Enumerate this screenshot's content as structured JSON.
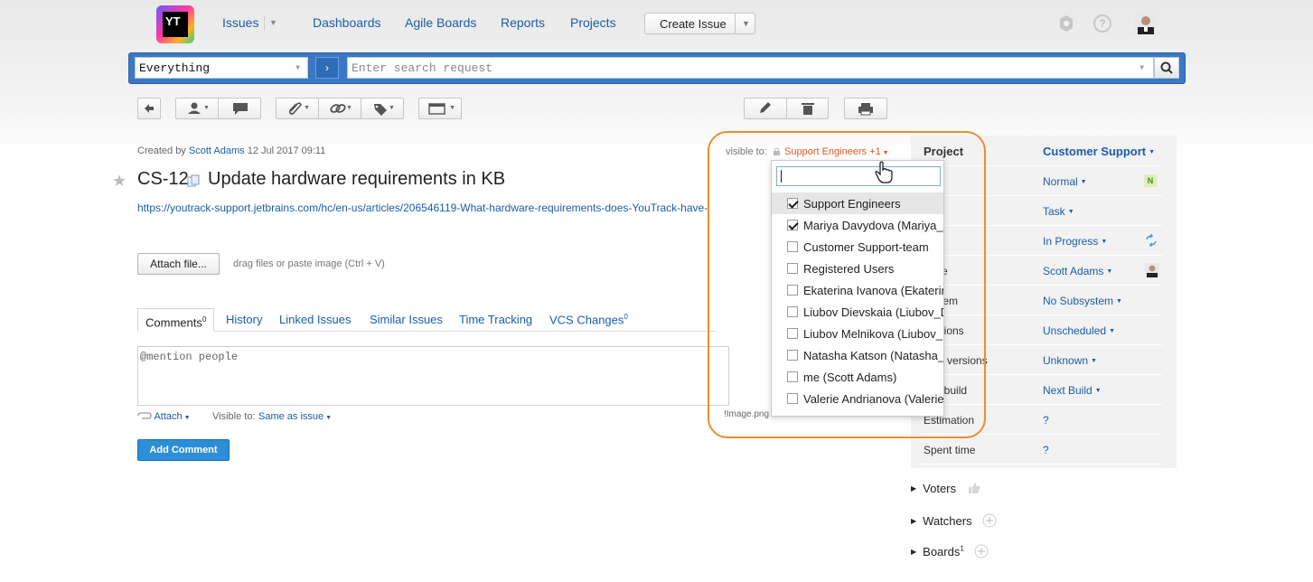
{
  "nav": {
    "logo_text": "YT",
    "issues": "Issues",
    "dashboards": "Dashboards",
    "agile_boards": "Agile Boards",
    "reports": "Reports",
    "projects": "Projects",
    "create_issue": "Create Issue"
  },
  "search": {
    "context": "Everything",
    "placeholder": "Enter search request"
  },
  "issue": {
    "created_prefix": "Created by",
    "author": "Scott Adams",
    "created_date": "12 Jul 2017 09:11",
    "id": "CS-12",
    "summary": "Update hardware requirements in KB",
    "link": "https://youtrack-support.jetbrains.com/hc/en-us/articles/206546119-What-hardware-requirements-does-YouTrack-have-",
    "attach_file": "Attach file...",
    "drag_hint": "drag files or paste image (Ctrl + V)"
  },
  "tabs": {
    "comments": "Comments",
    "comments_count": "0",
    "history": "History",
    "linked": "Linked Issues",
    "similar": "Similar Issues",
    "time": "Time Tracking",
    "vcs": "VCS Changes",
    "vcs_count": "0"
  },
  "comment": {
    "placeholder": "@mention people",
    "attach": "Attach",
    "visible_to_label": "Visible to:",
    "visible_to_value": "Same as issue",
    "image_file": "!Image.png",
    "add_button": "Add Comment"
  },
  "visibility": {
    "label": "visible to:",
    "value": "Support Engineers +1",
    "options": [
      {
        "label": "Support Engineers",
        "checked": true
      },
      {
        "label": "Mariya Davydova (Mariya_",
        "checked": true
      },
      {
        "label": "Customer Support-team",
        "checked": false
      },
      {
        "label": "Registered Users",
        "checked": false
      },
      {
        "label": "Ekaterina Ivanova (Ekaterin",
        "checked": false
      },
      {
        "label": "Liubov Dievskaia (Liubov_D",
        "checked": false
      },
      {
        "label": "Liubov Melnikova (Liubov_",
        "checked": false
      },
      {
        "label": "Natasha Katson (Natasha_",
        "checked": false
      },
      {
        "label": "me (Scott Adams)",
        "checked": false
      },
      {
        "label": "Valerie Andrianova (Valerie",
        "checked": false
      }
    ]
  },
  "fields": [
    {
      "name": "Project",
      "value": "Customer Support",
      "bold": true
    },
    {
      "name": "rity",
      "value": "Normal",
      "badge": "N"
    },
    {
      "name": "e",
      "value": "Task"
    },
    {
      "name": "e",
      "value": "In Progress"
    },
    {
      "name": "gnee",
      "value": "Scott Adams"
    },
    {
      "name": "system",
      "value": "No Subsystem"
    },
    {
      "name": "versions",
      "value": "Unscheduled"
    },
    {
      "name": "cted versions",
      "value": "Unknown"
    },
    {
      "name": "d in build",
      "value": "Next Build"
    },
    {
      "name": "Estimation",
      "value": "?"
    },
    {
      "name": "Spent time",
      "value": "?"
    }
  ],
  "sections": {
    "voters": "Voters",
    "watchers": "Watchers",
    "boards": "Boards",
    "boards_count": "1"
  },
  "colors": {
    "accent": "#1a5ea8",
    "search_bar": "#3a78c5",
    "highlight": "#f08c2e",
    "visibility": "#e0581c",
    "add_button": "#2d8ed8"
  }
}
